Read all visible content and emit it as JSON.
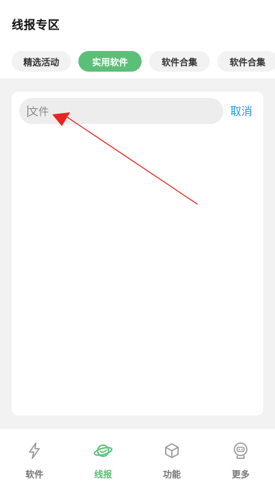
{
  "header": {
    "title": "线报专区"
  },
  "tabs": [
    {
      "label": "精选活动",
      "active": false
    },
    {
      "label": "实用软件",
      "active": true
    },
    {
      "label": "软件合集",
      "active": false
    },
    {
      "label": "软件合集",
      "active": false
    }
  ],
  "search": {
    "value": "文件",
    "placeholder": "文件",
    "cancel_label": "取消"
  },
  "bottom_nav": [
    {
      "label": "软件",
      "icon": "lightning-icon",
      "active": false
    },
    {
      "label": "线报",
      "icon": "planet-icon",
      "active": true
    },
    {
      "label": "功能",
      "icon": "cube-icon",
      "active": false
    },
    {
      "label": "更多",
      "icon": "robot-icon",
      "active": false
    }
  ],
  "colors": {
    "accent_green": "#5cbf78",
    "link_blue": "#1a9be0",
    "annotation_red": "#e8261f"
  }
}
